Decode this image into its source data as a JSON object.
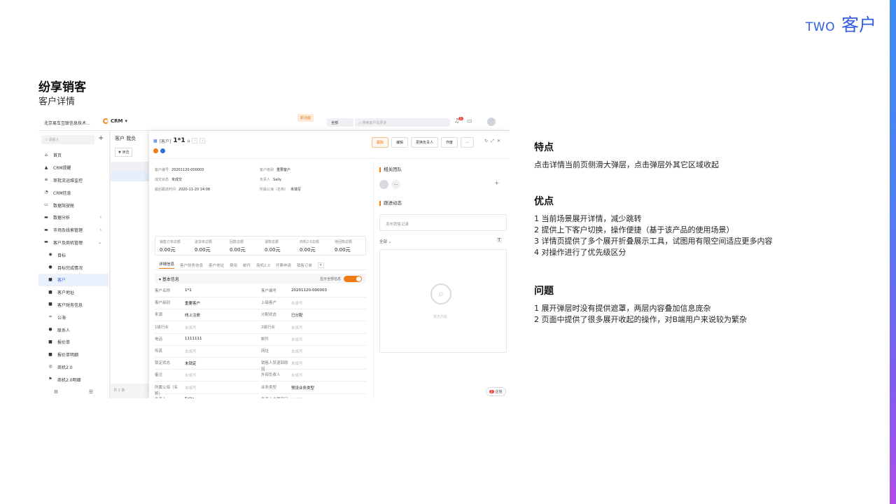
{
  "corner": {
    "en": "TWO",
    "cn": "客户"
  },
  "title": "纷享销客",
  "subtitle": "客户详情",
  "app": {
    "org": "北京易车互联信息技术...",
    "crm": "CRM",
    "new_badge": "新功能",
    "scope": "全部",
    "search_placeholder": "搜索客户及更多",
    "bell_count": "2",
    "sidebar_search": "请输入",
    "sidebar": [
      {
        "label": "首页",
        "icon": "home-icon",
        "glyph": "⌂"
      },
      {
        "label": "CRM提醒",
        "icon": "bell-icon",
        "glyph": "▲"
      },
      {
        "label": "审批流运维监控",
        "icon": "flow-icon",
        "glyph": "≡"
      },
      {
        "label": "CRM信息",
        "icon": "pie-icon",
        "glyph": "◔"
      },
      {
        "label": "数据驾驶舱",
        "icon": "monitor-icon",
        "glyph": "▭"
      },
      {
        "label": "数据分析",
        "icon": "folder-icon",
        "glyph": "▬",
        "arrow": "›"
      },
      {
        "label": "市场及线索管理",
        "icon": "folder-icon",
        "glyph": "▬",
        "arrow": "›"
      },
      {
        "label": "客户及商机管理",
        "icon": "folder-icon",
        "glyph": "▬",
        "arrow": "⌄"
      },
      {
        "label": "目标",
        "icon": "target-icon",
        "glyph": "◉",
        "sub": true
      },
      {
        "label": "目标完成情况",
        "icon": "check-icon",
        "glyph": "●",
        "sub": true
      },
      {
        "label": "客户",
        "icon": "customer-icon",
        "glyph": "■",
        "sub": true,
        "active": true
      },
      {
        "label": "客户地址",
        "icon": "address-icon",
        "glyph": "■",
        "sub": true
      },
      {
        "label": "客户财务信息",
        "icon": "finance-icon",
        "glyph": "■",
        "sub": true
      },
      {
        "label": "公海",
        "icon": "sea-icon",
        "glyph": "≈",
        "sub": true
      },
      {
        "label": "联系人",
        "icon": "contact-icon",
        "glyph": "●",
        "sub": true
      },
      {
        "label": "报价单",
        "icon": "quote-icon",
        "glyph": "■",
        "sub": true
      },
      {
        "label": "报价单明细",
        "icon": "quote-detail-icon",
        "glyph": "■",
        "sub": true
      },
      {
        "label": "商机2.0",
        "icon": "opportunity-icon",
        "glyph": "◎",
        "sub": true
      },
      {
        "label": "商机2.0明细",
        "icon": "flag-icon",
        "glyph": "⚑",
        "sub": true
      }
    ],
    "list_tabs": "客户  我负",
    "filter": "筛选",
    "list_footer": "共 1 条",
    "modal": {
      "type": "[客户]",
      "name": "1*1",
      "actions": [
        "跟踪",
        "编辑",
        "更换负责人",
        "作废",
        "..."
      ],
      "summary_left": [
        {
          "k": "客户编号",
          "v": "20201120-000003"
        },
        {
          "k": "成交状态",
          "v": "未成交"
        },
        {
          "k": "最后跟进时间",
          "v": "2020-11-20 14:08"
        }
      ],
      "summary_right": [
        {
          "k": "客户级别",
          "v": "重要客户"
        },
        {
          "k": "负责人",
          "v": "Sally"
        },
        {
          "k": "所属公海（名称）",
          "v": "未填写"
        }
      ],
      "stats": [
        {
          "k": "销售订单总额",
          "v": "0.00元"
        },
        {
          "k": "退货单总额",
          "v": "0.00元"
        },
        {
          "k": "回款总额",
          "v": "0.00元"
        },
        {
          "k": "退款总额",
          "v": "0.00元"
        },
        {
          "k": "商机2.0总额",
          "v": "0.00元"
        },
        {
          "k": "待回款总额",
          "v": "0.00元"
        }
      ],
      "tabs": [
        "详细信息",
        "客户财务信息",
        "客户地址",
        "费用",
        "邮件",
        "商机2.0",
        "开票申请",
        "销售订单"
      ],
      "basic_info": "基本信息",
      "show_all": "显示全部信息",
      "fields_left": [
        {
          "k": "客户名称",
          "v": "1*1"
        },
        {
          "k": "客户级别",
          "v": "重要客户"
        },
        {
          "k": "来源",
          "v": "线上注册"
        },
        {
          "k": "1级行业",
          "v": "未填写",
          "empty": true
        },
        {
          "k": "电话",
          "v": "1111111"
        },
        {
          "k": "传真",
          "v": "未填写",
          "empty": true
        },
        {
          "k": "锁定状态",
          "v": "未锁定"
        },
        {
          "k": "备注",
          "v": "未填写",
          "empty": true
        },
        {
          "k": "所属公海（名称）",
          "v": "未填写",
          "empty": true
        },
        {
          "k": "负责人",
          "v": "Sally"
        }
      ],
      "fields_right": [
        {
          "k": "客户编号",
          "v": "20201120-000003"
        },
        {
          "k": "上级客户",
          "v": "未填写",
          "empty": true
        },
        {
          "k": "分配状态",
          "v": "已分配"
        },
        {
          "k": "2级行业",
          "v": "未填写",
          "empty": true
        },
        {
          "k": "邮件",
          "v": "未填写",
          "empty": true
        },
        {
          "k": "网址",
          "v": "未填写",
          "empty": true
        },
        {
          "k": "销售人员退回原因",
          "v": "未填写",
          "empty": true
        },
        {
          "k": "外部负责人",
          "v": "未填写",
          "empty": true
        },
        {
          "k": "业务类型",
          "v": "预设业务类型"
        },
        {
          "k": "负责人主属部门",
          "v": "未填写",
          "empty": true
        }
      ],
      "team_title": "相关团队",
      "follow_title": "跟进动态",
      "post_placeholder": "发布销售记录",
      "filter_all": "全部",
      "empty_text": "暂无内容",
      "chat": "企信",
      "chat_count": "2"
    }
  },
  "sections": [
    {
      "h": "特点",
      "lines": [
        "点击详情当前页侧滑大弹层，点击弹层外其它区域收起"
      ]
    },
    {
      "h": "优点",
      "lines": [
        "1 当前场景展开详情，减少跳转",
        "2 提供上下客户切换，操作便捷（基于该产品的使用场景）",
        "3 详情页提供了多个展开折叠展示工具，试图用有限空间适应更多内容",
        "4 对操作进行了优先级区分"
      ]
    },
    {
      "h": "问题",
      "lines": [
        "1 展开弹层时没有提供遮罩，两层内容叠加信息庞杂",
        "2 页面中提供了很多展开收起的操作，对B端用户来说较为繁杂"
      ]
    }
  ],
  "colors": {
    "accent": "#f07a14",
    "brand": "#2f5ee0",
    "active": "#2f6fd8"
  }
}
